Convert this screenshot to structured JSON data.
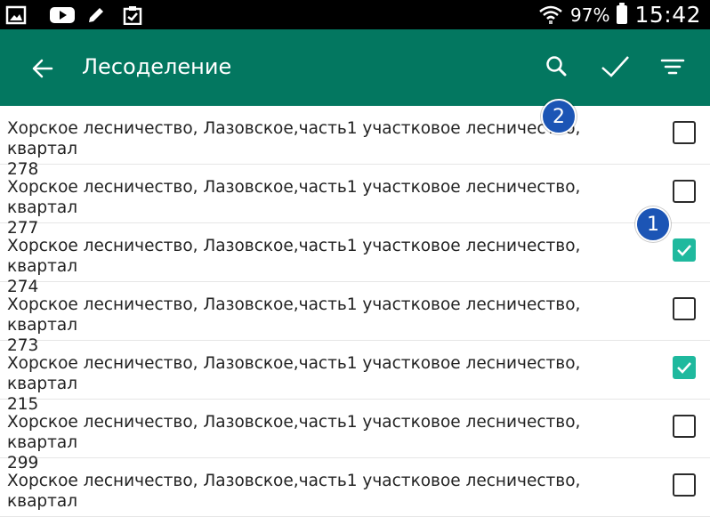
{
  "status_bar": {
    "battery_text": "97%",
    "time": "15:42",
    "icons": [
      "gallery-icon",
      "youtube-icon",
      "pencil-icon",
      "clipboard-check-icon",
      "wifi-icon",
      "battery-icon"
    ]
  },
  "toolbar": {
    "title": "Лесоделение",
    "background": "#037760",
    "icons": [
      "back-arrow-icon",
      "search-icon",
      "checkmark-icon",
      "filter-icon"
    ]
  },
  "rows": [
    {
      "line1": "Хорское лесничество, Лазовское,часть1 участковое лесничество, квартал",
      "line2": "278",
      "checked": false
    },
    {
      "line1": "Хорское лесничество, Лазовское,часть1 участковое лесничество, квартал",
      "line2": "277",
      "checked": false
    },
    {
      "line1": "Хорское лесничество, Лазовское,часть1 участковое лесничество, квартал",
      "line2": "274",
      "checked": true
    },
    {
      "line1": "Хорское лесничество, Лазовское,часть1 участковое лесничество, квартал",
      "line2": "273",
      "checked": false
    },
    {
      "line1": "Хорское лесничество, Лазовское,часть1 участковое лесничество, квартал",
      "line2": "215",
      "checked": true
    },
    {
      "line1": "Хорское лесничество, Лазовское,часть1 участковое лесничество, квартал",
      "line2": "299",
      "checked": false
    },
    {
      "line1": "Хорское лесничество, Лазовское,часть1 участковое лесничество, квартал",
      "line2": "",
      "checked": false
    }
  ],
  "badges": {
    "one": "1",
    "two": "2"
  },
  "colors": {
    "accent": "#1fb99e",
    "badge": "#1c55b5"
  }
}
